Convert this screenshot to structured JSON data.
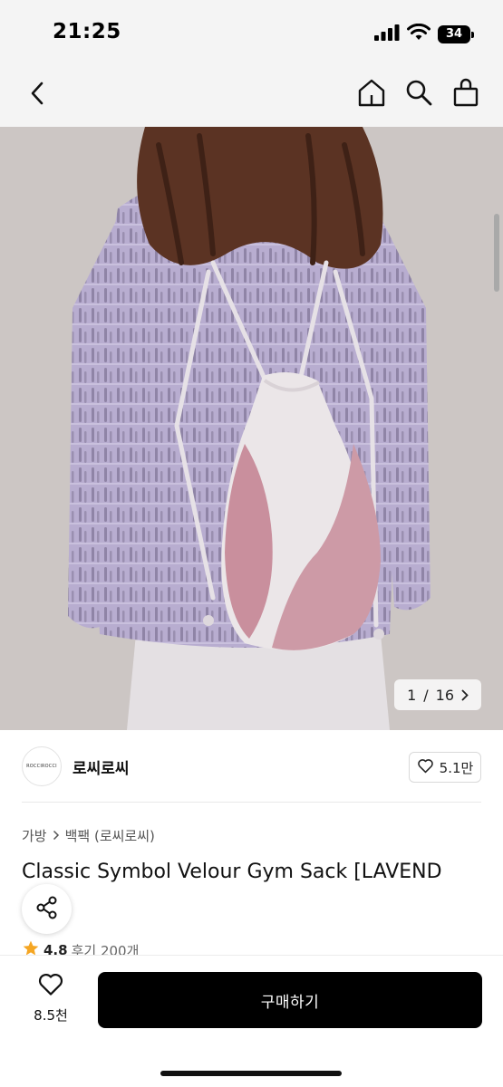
{
  "status_bar": {
    "time": "21:25",
    "battery": "34"
  },
  "nav": {
    "back_icon": "chevron-left-icon",
    "home_icon": "home-icon",
    "search_icon": "search-icon",
    "cart_icon": "shopping-bag-icon"
  },
  "gallery": {
    "current": "1",
    "separator": "/",
    "total": "16"
  },
  "brand": {
    "logo_text": "ROCCIROCCI",
    "name": "로씨로씨",
    "likes": "5.1만"
  },
  "breadcrumb": {
    "category": "가방",
    "subcategory": "백팩 (로씨로씨)"
  },
  "product": {
    "title": "Classic Symbol Velour Gym Sack [LAVEND",
    "rating": "4.8",
    "reviews": "후기 200개"
  },
  "bottom_bar": {
    "wish_count": "8.5천",
    "buy_label": "구매하기"
  },
  "colors": {
    "accent_star": "#f5a623",
    "primary_button": "#000000",
    "bar_background": "#f4f4f4"
  }
}
